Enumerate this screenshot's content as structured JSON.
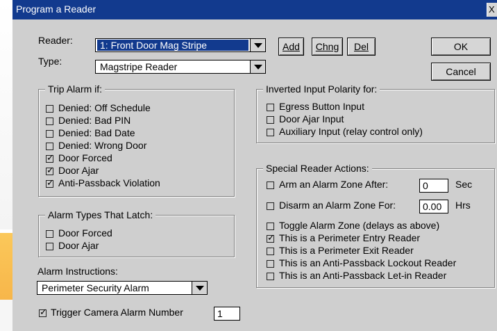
{
  "window": {
    "title": "Program a Reader",
    "close_label": "X"
  },
  "reader": {
    "label": "Reader:",
    "value": "1: Front Door Mag Stripe"
  },
  "type": {
    "label": "Type:",
    "value": "Magstripe Reader"
  },
  "buttons": {
    "add": "Add",
    "change": "Chng",
    "delete": "Del",
    "ok": "OK",
    "cancel": "Cancel"
  },
  "trip_alarm": {
    "title": "Trip Alarm if:",
    "items": [
      {
        "label": "Denied: Off Schedule",
        "checked": false
      },
      {
        "label": "Denied: Bad PIN",
        "checked": false
      },
      {
        "label": "Denied: Bad Date",
        "checked": false
      },
      {
        "label": "Denied: Wrong Door",
        "checked": false
      },
      {
        "label": "Door Forced",
        "checked": true
      },
      {
        "label": "Door Ajar",
        "checked": true
      },
      {
        "label": "Anti-Passback Violation",
        "checked": true
      }
    ]
  },
  "latch": {
    "title": "Alarm Types That Latch:",
    "items": [
      {
        "label": "Door Forced",
        "checked": false
      },
      {
        "label": "Door Ajar",
        "checked": false
      }
    ]
  },
  "instructions": {
    "label": "Alarm Instructions:",
    "value": "Perimeter Security Alarm"
  },
  "camera": {
    "label": "Trigger Camera Alarm Number",
    "checked": true,
    "value": "1"
  },
  "inverted": {
    "title": "Inverted Input Polarity for:",
    "items": [
      {
        "label": "Egress Button Input",
        "checked": false
      },
      {
        "label": "Door Ajar Input",
        "checked": false
      },
      {
        "label": "Auxiliary Input (relay control only)",
        "checked": false
      }
    ]
  },
  "special": {
    "title": "Special Reader Actions:",
    "arm": {
      "label": "Arm an Alarm Zone After:",
      "checked": false,
      "value": "0",
      "unit": "Sec"
    },
    "disarm": {
      "label": "Disarm an Alarm Zone For:",
      "checked": false,
      "value": "0.00",
      "unit": "Hrs"
    },
    "items": [
      {
        "label": "Toggle Alarm Zone (delays as above)",
        "checked": false
      },
      {
        "label": "This is a Perimeter Entry Reader",
        "checked": true
      },
      {
        "label": "This is a Perimeter Exit Reader",
        "checked": false
      },
      {
        "label": "This is an Anti-Passback Lockout Reader",
        "checked": false
      },
      {
        "label": "This is an Anti-Passback Let-in Reader",
        "checked": false
      }
    ]
  }
}
